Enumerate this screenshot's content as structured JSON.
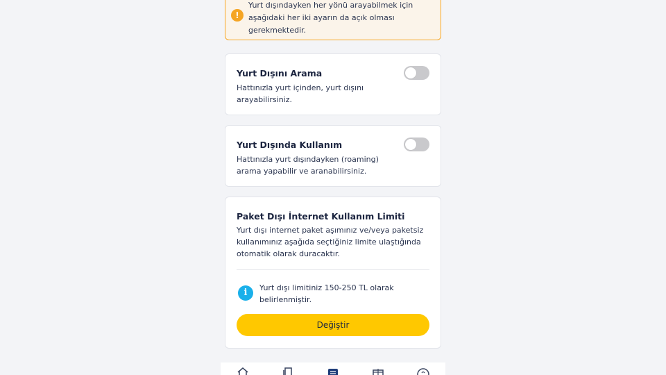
{
  "warning": {
    "icon": "exclamation-icon",
    "text_line1": "Yurt dışındayken her yönü arayabilmek için",
    "text_line2": "aşağıdaki her iki ayarın da açık olması",
    "text_line3": "gerekmektedir."
  },
  "international_calling": {
    "title": "Yurt Dışını Arama",
    "desc_line1": "Hattınızla yurt içinden, yurt dışını",
    "desc_line2": "arayabilirsiniz.",
    "enabled": false
  },
  "roaming": {
    "title": "Yurt Dışında Kullanım",
    "desc_line1": "Hattınızla yurt dışındayken (roaming)",
    "desc_line2": "arama yapabilir ve aranabilirsiniz.",
    "enabled": false
  },
  "internet_limit": {
    "title": "Paket Dışı İnternet Kullanım Limiti",
    "desc_line1": "Yurt dışı internet paket aşımınız ve/veya paketsiz",
    "desc_line2": "kullanımınız aşağıda seçtiğiniz limite ulaştığında",
    "desc_line3": "otomatik olarak duracaktır.",
    "info_icon": "info-icon",
    "info_line1": "Yurt dışı limitiniz 150-250 TL olarak",
    "info_line2": "belirlenmiştir.",
    "button_label": "Değiştir"
  },
  "bottom_nav": {
    "items": [
      "home-icon",
      "documents-icon",
      "list-icon",
      "gift-icon",
      "help-icon"
    ],
    "active": "list-icon"
  },
  "colors": {
    "accent_yellow": "#ffc800",
    "warning_orange": "#f5a524",
    "info_blue": "#1ab0ea",
    "nav_active": "#1f3d7a"
  }
}
